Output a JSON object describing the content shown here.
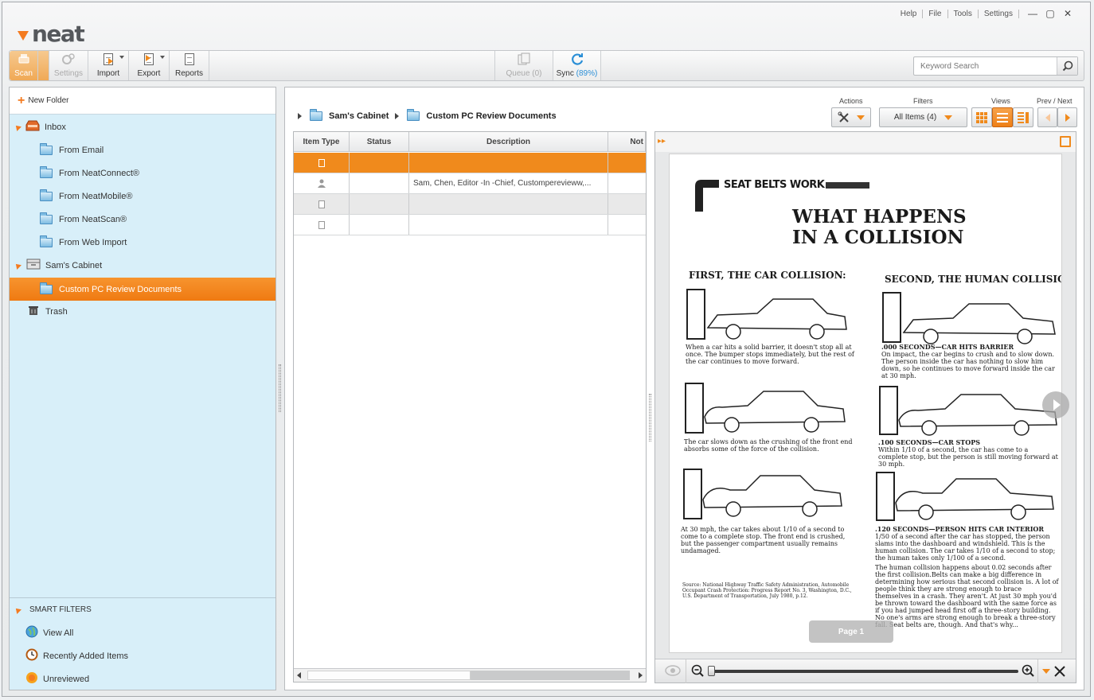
{
  "app": {
    "logo": "neat"
  },
  "topmenu": {
    "help": "Help",
    "file": "File",
    "tools": "Tools",
    "settings": "Settings"
  },
  "toolbar": {
    "scan": "Scan",
    "settings": "Settings",
    "import": "Import",
    "export": "Export",
    "reports": "Reports",
    "queue": "Queue (0)",
    "sync": "Sync",
    "sync_pct": "(89%)"
  },
  "search": {
    "placeholder": "Keyword Search"
  },
  "sidebar": {
    "new_folder": "New Folder",
    "inbox": "Inbox",
    "inbox_items": [
      "From Email",
      "From NeatConnect®",
      "From NeatMobile®",
      "From NeatScan®",
      "From Web Import"
    ],
    "cabinet": "Sam's Cabinet",
    "selected_folder": "Custom PC Review Documents",
    "trash": "Trash",
    "smart_filters": "SMART FILTERS",
    "filters": [
      "View All",
      "Recently Added Items",
      "Unreviewed"
    ]
  },
  "breadcrumb": {
    "cabinet": "Sam's Cabinet",
    "folder": "Custom PC Review Documents"
  },
  "controls": {
    "actions": "Actions",
    "filters": "Filters",
    "filter_value": "All Items (4)",
    "views": "Views",
    "prev_next": "Prev / Next"
  },
  "table": {
    "columns": [
      "Item Type",
      "Status",
      "Description",
      "Not"
    ],
    "rows": [
      {
        "type": "document",
        "status": "",
        "description": ""
      },
      {
        "type": "contact",
        "status": "",
        "description": "Sam, Chen, Editor -In -Chief, Customperevieww,..."
      },
      {
        "type": "document",
        "status": "",
        "description": ""
      },
      {
        "type": "document",
        "status": "",
        "description": ""
      }
    ]
  },
  "preview": {
    "page_badge": "Page 1",
    "document": {
      "banner": "SEAT BELTS WORK",
      "headline1": "WHAT HAPPENS",
      "headline2": "IN A COLLISION",
      "left_heading": "FIRST, THE CAR COLLISION:",
      "right_heading": "SECOND, THE HUMAN COLLISION",
      "cap1": "When a car hits a solid barrier, it doesn't stop all at once. The bumper stops immediately, but the rest of the car continues to move forward.",
      "cap2": "The car slows down as the crushing of the front end absorbs some of the force of the collision.",
      "cap3": "At 30 mph, the car takes about 1/10 of a second to come to a complete stop. The front end is crushed, but the passenger compartment usually remains undamaged.",
      "r1_title": ".000 SECONDS—CAR HITS BARRIER",
      "r1": "On impact, the car begins to crush and to slow down. The person inside the car has nothing to slow him down, so he continues to move forward inside the car at 30 mph.",
      "r2_title": ".100 SECONDS—CAR STOPS",
      "r2": "Within 1/10 of a second, the car has come to a complete stop, but the person is still moving forward at 30 mph.",
      "r3_title": ".120 SECONDS—PERSON HITS CAR INTERIOR",
      "r3": "1/50 of a second after the car has stopped, the person slams into the dashboard and windshield. This is the human collision. The car takes 1/10 of a second to stop; the human takes only 1/100 of a second.",
      "r4": "The human collision happens about 0.02 seconds after the first collision.Belts can make a big difference in determining how serious that second collision is. A lot of people think they are strong enough to brace themselves in a crash. They aren't. At just 30 mph you'd be thrown toward the dashboard with the same force as if you had jumped head first off a three-story building. No one's arms are strong enough to break a three-story fall. Seat belts are, though. And that's why...",
      "source": "Source: National Highway Traffic Safety Administration, Automobile Occupant Crash Protection: Progress Report No. 3, Washington, D.C., U.S. Department of Transportation, July 1980, p.12."
    }
  }
}
